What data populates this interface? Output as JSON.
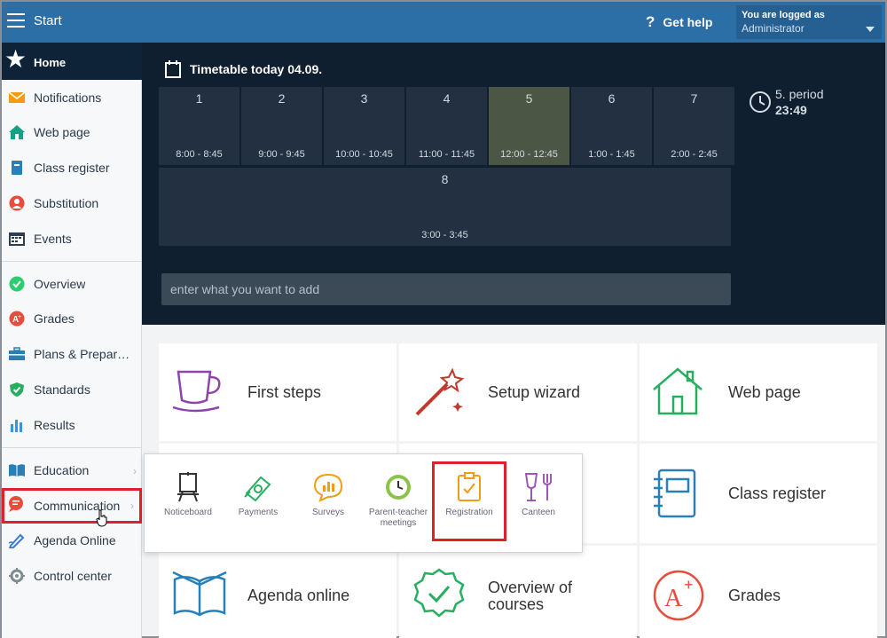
{
  "topbar": {
    "title": "Start",
    "help_label": "Get help",
    "user_line1": "You are logged as",
    "user_line2": "Administrator"
  },
  "sidebar": {
    "home": "Home",
    "items": [
      {
        "label": "Notifications",
        "icon": "envelope-icon"
      },
      {
        "label": "Web page",
        "icon": "house-icon"
      },
      {
        "label": "Class register",
        "icon": "book-icon"
      },
      {
        "label": "Substitution",
        "icon": "person-icon"
      },
      {
        "label": "Events",
        "icon": "calendar-icon"
      },
      {
        "label": "Overview",
        "icon": "check-circle-icon"
      },
      {
        "label": "Grades",
        "icon": "grade-icon"
      },
      {
        "label": "Plans & Preparations",
        "icon": "briefcase-icon"
      },
      {
        "label": "Standards",
        "icon": "shield-icon"
      },
      {
        "label": "Results",
        "icon": "bar-chart-icon"
      },
      {
        "label": "Education",
        "icon": "open-book-icon"
      },
      {
        "label": "Communication",
        "icon": "chat-icon"
      },
      {
        "label": "Agenda Online",
        "icon": "pen-icon"
      },
      {
        "label": "Control center",
        "icon": "gear-icon"
      }
    ]
  },
  "timetable": {
    "title": "Timetable today 04.09.",
    "lessons": [
      {
        "num": "1",
        "time": "8:00 - 8:45"
      },
      {
        "num": "2",
        "time": "9:00 - 9:45"
      },
      {
        "num": "3",
        "time": "10:00 - 10:45"
      },
      {
        "num": "4",
        "time": "11:00 - 11:45"
      },
      {
        "num": "5",
        "time": "12:00 - 12:45"
      },
      {
        "num": "6",
        "time": "1:00 - 1:45"
      },
      {
        "num": "7",
        "time": "2:00 - 2:45"
      },
      {
        "num": "8",
        "time": "3:00 - 3:45"
      }
    ],
    "current_period": "5. period",
    "clock": "23:49",
    "add_placeholder": "enter what you want to add"
  },
  "tiles": [
    {
      "label": "First steps",
      "color": "#8e44ad"
    },
    {
      "label": "Setup wizard",
      "color": "#c0392b"
    },
    {
      "label": "Web page",
      "color": "#27ae60"
    },
    {
      "label": "Class register",
      "color": "#2980b9"
    },
    {
      "label": "Agenda online",
      "color": "#2980b9"
    },
    {
      "label": "Overview of courses",
      "color": "#27ae60"
    },
    {
      "label": "Grades",
      "color": "#e74c3c"
    }
  ],
  "popup": {
    "items": [
      {
        "label": "Noticeboard"
      },
      {
        "label": "Payments"
      },
      {
        "label": "Surveys"
      },
      {
        "label": "Parent-teacher meetings"
      },
      {
        "label": "Registration"
      },
      {
        "label": "Canteen"
      }
    ]
  },
  "colors": {
    "topbar": "#2c6ea6",
    "dark_panel": "#0f1f30",
    "highlight": "#e0202b"
  }
}
